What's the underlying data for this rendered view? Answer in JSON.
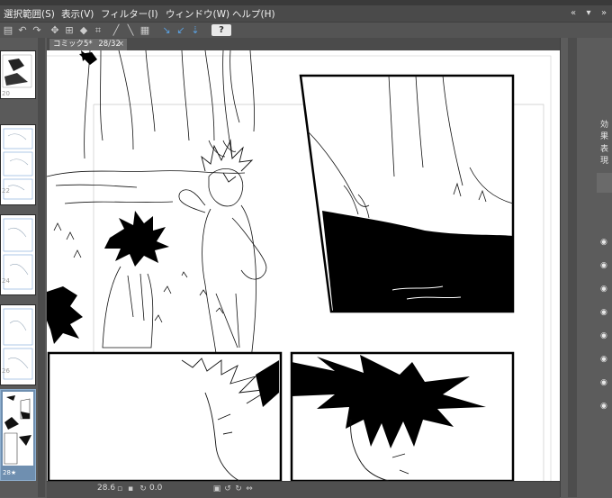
{
  "menu": {
    "items": [
      "選択範囲(S)",
      "表示(V)",
      "フィルター(I)",
      "ウィンドウ(W)",
      "ヘルプ(H)"
    ]
  },
  "toolbar": {
    "help_label": "?"
  },
  "document_tab": {
    "name": "コミック5*",
    "page": "28/32",
    "close": "×"
  },
  "page_list": {
    "labels": [
      "20",
      "22",
      "24",
      "26",
      "28★"
    ]
  },
  "right_panel": {
    "label_a": "効果",
    "label_b": "表現"
  },
  "status": {
    "zoom": "28.6",
    "angle": "0.0"
  },
  "colors": {
    "ui_dark": "#4a4a4a",
    "ui_mid": "#5c5c5c",
    "selected": "#6f8fb0",
    "ink": "#000000",
    "paper": "#ffffff"
  }
}
